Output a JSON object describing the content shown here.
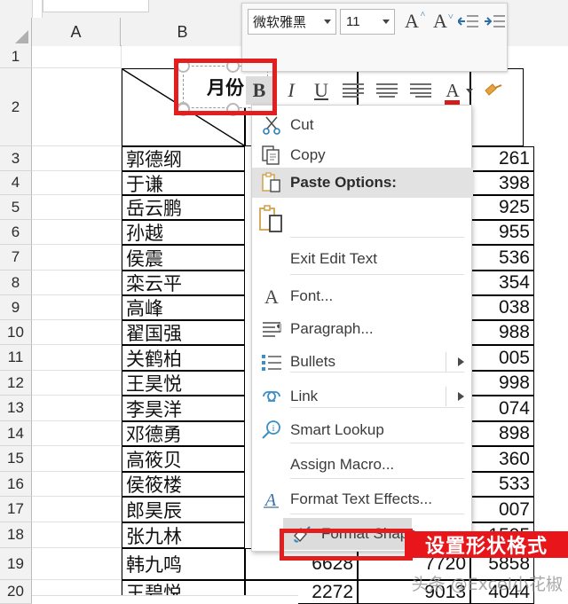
{
  "app": {
    "name": "Excel",
    "sheet_tab_label": ""
  },
  "grid": {
    "column_headers": [
      "A",
      "B"
    ],
    "row_headers": [
      "1",
      "2",
      "3",
      "4",
      "5",
      "6",
      "7",
      "8",
      "9",
      "10",
      "11",
      "12",
      "13",
      "14",
      "15",
      "16",
      "17",
      "18",
      "19",
      "20"
    ],
    "corner_icon": "select-all-triangle-icon"
  },
  "table": {
    "header_cell_note": "diagonal split header cell",
    "name_column_label": "",
    "names": [
      "郭德纲",
      "于谦",
      "岳云鹏",
      "孙越",
      "侯震",
      "栾云平",
      "高峰",
      "翟国强",
      "关鹤柏",
      "王昊悦",
      "李昊洋",
      "邓德勇",
      "高筱贝",
      "侯筱楼",
      "郎昊辰",
      "张九林",
      "韩九鸣"
    ],
    "partial_names_bottom": [
      "王碧悦"
    ],
    "right_column_partial_values": [
      "261",
      "398",
      "925",
      "955",
      "536",
      "354",
      "038",
      "988",
      "005",
      "998",
      "074",
      "898",
      "360",
      "533",
      "007",
      "1505"
    ],
    "last_row_values": [
      "6628",
      "7720",
      "5858"
    ],
    "below_last_row_values": [
      "2272",
      "9013",
      "4044"
    ]
  },
  "shape": {
    "text": "月份",
    "handles": [
      "handle-top-left",
      "handle-top-center",
      "handle-top-right",
      "handle-middle-left",
      "handle-bottom-left",
      "handle-bottom-center"
    ],
    "selected": true
  },
  "mini_toolbar": {
    "font_name": "微软雅黑",
    "font_size": "11",
    "buttons": [
      {
        "name": "grow-font-icon",
        "label": "A"
      },
      {
        "name": "shrink-font-icon",
        "label": "A"
      },
      {
        "name": "decrease-indent-icon",
        "label": ""
      },
      {
        "name": "increase-indent-icon",
        "label": ""
      },
      {
        "name": "bold-button",
        "label": "B",
        "active": true
      },
      {
        "name": "italic-button",
        "label": "I"
      },
      {
        "name": "underline-button",
        "label": "U"
      },
      {
        "name": "align-left-button",
        "label": ""
      },
      {
        "name": "align-center-button",
        "label": ""
      },
      {
        "name": "align-right-button",
        "label": ""
      },
      {
        "name": "font-color-button",
        "label": "A"
      },
      {
        "name": "format-painter-button",
        "label": ""
      }
    ],
    "font_color": "#d01f1f"
  },
  "context_menu": {
    "items": [
      {
        "label": "Cut",
        "icon": "scissors-icon",
        "state": "normal",
        "submenu": false
      },
      {
        "label": "Copy",
        "icon": "copy-icon",
        "state": "normal",
        "submenu": false
      },
      {
        "label": "Paste Options:",
        "icon": "paste-icon",
        "state": "highlighted",
        "submenu": false
      },
      {
        "label": "",
        "icon": "paste-option-icon",
        "state": "normal",
        "submenu": false
      },
      {
        "label": "Exit Edit Text",
        "icon": "",
        "state": "normal",
        "submenu": false
      },
      {
        "label": "Font...",
        "icon": "font-a-icon",
        "state": "normal",
        "submenu": false
      },
      {
        "label": "Paragraph...",
        "icon": "paragraph-icon",
        "state": "normal",
        "submenu": false
      },
      {
        "label": "Bullets",
        "icon": "bullets-icon",
        "state": "normal",
        "submenu": true
      },
      {
        "label": "Link",
        "icon": "link-icon",
        "state": "normal",
        "submenu": true
      },
      {
        "label": "Smart Lookup",
        "icon": "smart-lookup-icon",
        "state": "normal",
        "submenu": false
      },
      {
        "label": "Assign Macro...",
        "icon": "",
        "state": "normal",
        "submenu": false
      },
      {
        "label": "Format Text Effects...",
        "icon": "text-effects-icon",
        "state": "normal",
        "submenu": false
      },
      {
        "label": "Format Shape...",
        "icon": "format-shape-icon",
        "state": "hovered",
        "submenu": false
      }
    ]
  },
  "annotations": {
    "shape_callout_name": "shape-highlight-box",
    "menu_callout_name": "format-shape-highlight-box",
    "red_label_text": "设置形状格式",
    "red_color": "#e8161a"
  },
  "watermark": {
    "text": "头条 @Excel小花椒"
  }
}
